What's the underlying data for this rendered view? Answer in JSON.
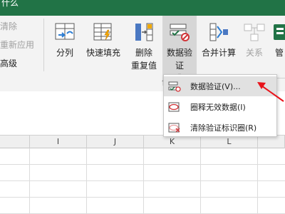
{
  "window": {
    "title": "什么"
  },
  "ribbon": {
    "left_commands": [
      {
        "label": "清除",
        "enabled": false
      },
      {
        "label": "重新应用",
        "enabled": false
      },
      {
        "label": "高级",
        "enabled": true
      }
    ],
    "tools": [
      {
        "label": "分列",
        "icon": "text-to-columns-icon"
      },
      {
        "label": "快速填充",
        "icon": "flash-fill-icon"
      },
      {
        "label": "删除\n重复值",
        "icon": "remove-duplicates-icon"
      },
      {
        "label": "数据验\n证",
        "icon": "data-validation-icon",
        "dropdown": "▾"
      },
      {
        "label": "合并计算",
        "icon": "consolidate-icon"
      },
      {
        "label": "关系",
        "icon": "relationships-icon",
        "enabled": false
      },
      {
        "label": "管",
        "icon": "manage-data-model-icon"
      }
    ]
  },
  "dropdown_menu": {
    "items": [
      {
        "label": "数据验证(V)...",
        "icon": "data-validation-icon"
      },
      {
        "label": "圈释无效数据(I)",
        "icon": "circle-invalid-icon"
      },
      {
        "label": "清除验证标识圈(R)",
        "icon": "clear-circles-icon"
      }
    ]
  },
  "sheet": {
    "columns": [
      "I",
      "J",
      "K",
      "L"
    ]
  },
  "colors": {
    "accent": "#217346",
    "annotation_arrow": "#e8141b"
  }
}
